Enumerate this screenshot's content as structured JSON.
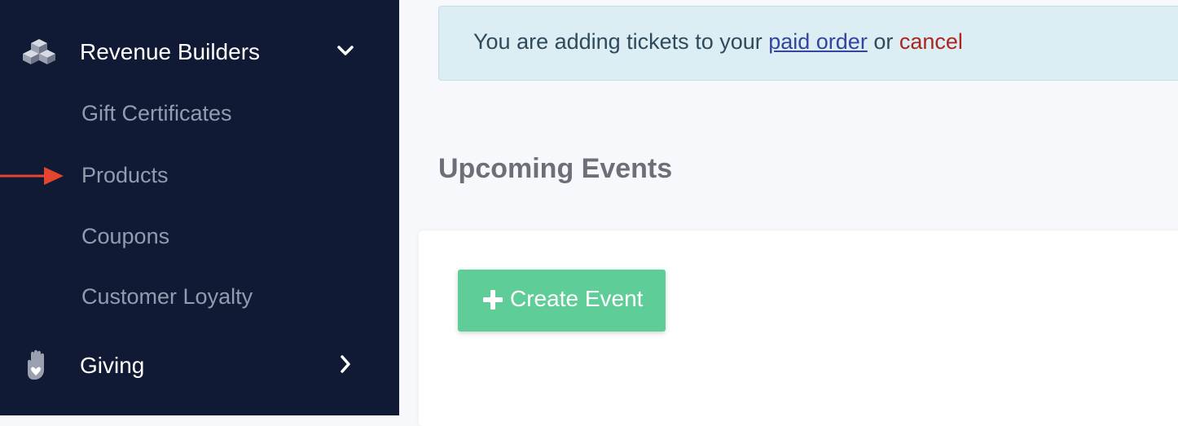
{
  "sidebar": {
    "revenue_builders": {
      "label": "Revenue Builders",
      "icon": "boxes-icon",
      "expanded": true,
      "items": [
        {
          "label": "Gift Certificates"
        },
        {
          "label": "Products"
        },
        {
          "label": "Coupons"
        },
        {
          "label": "Customer Loyalty"
        }
      ]
    },
    "giving": {
      "label": "Giving",
      "icon": "hand-heart-icon",
      "expanded": false
    },
    "pointer_target": "Products"
  },
  "alert": {
    "text_before": "You are adding tickets to your ",
    "link_label": "paid order",
    "text_middle": " or ",
    "cancel_label": "cancel"
  },
  "main": {
    "title": "Upcoming Events",
    "create_button_label": "Create Event"
  },
  "colors": {
    "sidebar_bg": "#111a35",
    "sub_item_text": "#939bae",
    "arrow": "#e5442f",
    "alert_bg": "#dcedf4",
    "link": "#3246a0",
    "cancel": "#a8271f",
    "create_button": "#5ecd97"
  }
}
